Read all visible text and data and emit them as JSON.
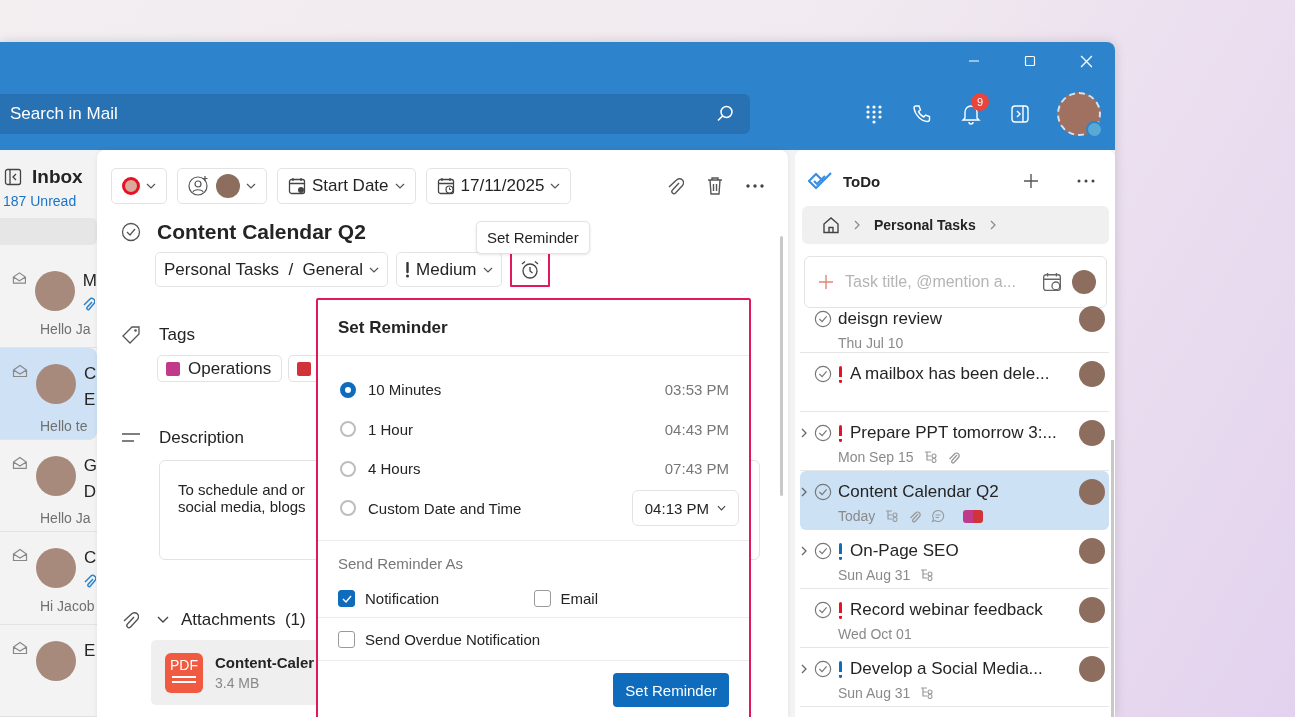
{
  "search": {
    "placeholder": "Search in Mail"
  },
  "notifications": {
    "badge": "9"
  },
  "mailbox": {
    "title": "Inbox",
    "unread": "187 Unread"
  },
  "messages": [
    {
      "sender": "M",
      "attachment": true,
      "preview": "Hello Ja",
      "selected": false
    },
    {
      "sender": "C",
      "line2": "E",
      "preview": "Hello te",
      "selected": true
    },
    {
      "sender": "G",
      "line2": "D",
      "preview": "Hello Ja",
      "selected": false
    },
    {
      "sender": "C",
      "attachment": true,
      "preview": "Hi Jacob",
      "selected": false
    },
    {
      "sender": "E",
      "selected": false
    }
  ],
  "task": {
    "start_date": "Start Date",
    "due_date": "17/11/2025",
    "title": "Content Calendar Q2",
    "list": "Personal Tasks",
    "separator": "/",
    "folder": "General",
    "priority": "Medium",
    "tags_label": "Tags",
    "tags": [
      {
        "label": "Operations",
        "color": "#c0398a"
      },
      {
        "color": "#d13438"
      }
    ],
    "description_label": "Description",
    "description": [
      "To schedule and or",
      "social media, blogs"
    ],
    "attachments": {
      "label": "Attachments",
      "count": "(1)",
      "expanded": true,
      "files": [
        {
          "type": "PDF",
          "name": "Content-Caler",
          "size": "3.4 MB"
        }
      ]
    }
  },
  "tooltip": "Set Reminder",
  "reminder": {
    "title": "Set Reminder",
    "options": [
      {
        "kind": "fixed",
        "label": "10 Minutes",
        "time": "03:53 PM",
        "selected": true
      },
      {
        "kind": "fixed",
        "label": "1 Hour",
        "time": "04:43 PM",
        "selected": false
      },
      {
        "kind": "fixed",
        "label": "4 Hours",
        "time": "07:43 PM",
        "selected": false
      },
      {
        "kind": "custom",
        "label": "Custom Date and Time",
        "time": "04:13 PM",
        "selected": false
      }
    ],
    "send_as_label": "Send Reminder As",
    "channels": [
      {
        "label": "Notification",
        "checked": true
      },
      {
        "label": "Email",
        "checked": false
      }
    ],
    "overdue": {
      "label": "Send Overdue Notification",
      "checked": false
    },
    "button": "Set Reminder"
  },
  "todo": {
    "title": "ToDo",
    "breadcrumb": "Personal Tasks",
    "input_placeholder": "Task title, @mention a...",
    "tasks": [
      {
        "title": "deisgn review",
        "date": "Thu Jul 10",
        "selected": false
      },
      {
        "title": "A mailbox has been dele...",
        "flag": {
          "color": "#e81123"
        },
        "selected": false
      },
      {
        "title": "Prepare PPT tomorrow 3:...",
        "date": "Mon Sep 15",
        "flag": {
          "color": "#e81123"
        },
        "expandable": true,
        "subtasks": true,
        "attachment": true,
        "selected": false
      },
      {
        "title": "Content Calendar Q2",
        "date": "Today",
        "expandable": true,
        "subtasks": true,
        "attachment": true,
        "comment": true,
        "tags": [
          {
            "color": "#c0398a"
          },
          {
            "color": "#d13438"
          }
        ],
        "selected": true
      },
      {
        "title": "On-Page SEO",
        "date": "Sun Aug 31",
        "flag": {
          "color": "#0f6cbd"
        },
        "expandable": true,
        "subtasks": true,
        "selected": false
      },
      {
        "title": "Record webinar feedback",
        "date": "Wed Oct 01",
        "flag": {
          "color": "#e81123"
        },
        "selected": false
      },
      {
        "title": "Develop a Social Media...",
        "date": "Sun Aug 31",
        "flag": {
          "color": "#0f6cbd"
        },
        "expandable": true,
        "subtasks": true,
        "selected": false
      }
    ]
  }
}
